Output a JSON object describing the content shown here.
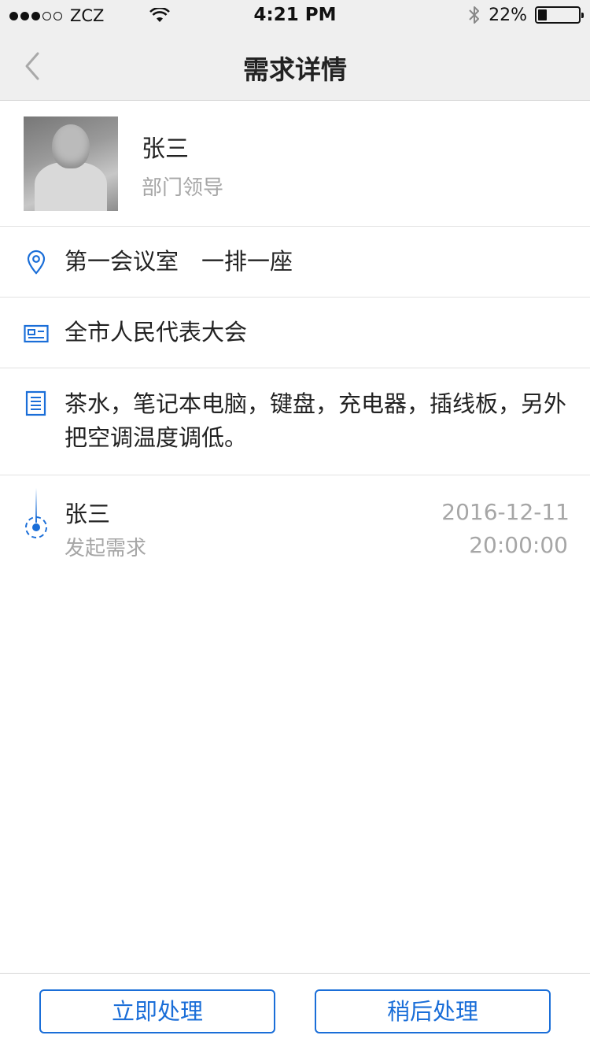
{
  "status_bar": {
    "carrier": "ZCZ",
    "time": "4:21 PM",
    "battery": "22%",
    "battery_level": 0.22,
    "signal_bars_filled": 3,
    "signal_bars_total": 5
  },
  "nav": {
    "title": "需求详情"
  },
  "profile": {
    "name": "张三",
    "role": "部门领导"
  },
  "details": {
    "location": "第一会议室　一排一座",
    "meeting": "全市人民代表大会",
    "requirements": "茶水，笔记本电脑，键盘，充电器，插线板，另外把空调温度调低。"
  },
  "timeline": [
    {
      "name": "张三",
      "action": "发起需求",
      "date": "2016-12-11",
      "time": "20:00:00"
    }
  ],
  "actions": {
    "process_now": "立即处理",
    "process_later": "稍后处理"
  },
  "colors": {
    "accent": "#1a6ed8",
    "secondary_text": "#a6a6a6",
    "nav_bg": "#efefef"
  },
  "icons": {
    "back": "chevron-left-icon",
    "location": "location-pin-icon",
    "meeting": "id-card-icon",
    "requirements": "document-icon",
    "bluetooth": "bluetooth-icon",
    "wifi": "wifi-icon"
  }
}
